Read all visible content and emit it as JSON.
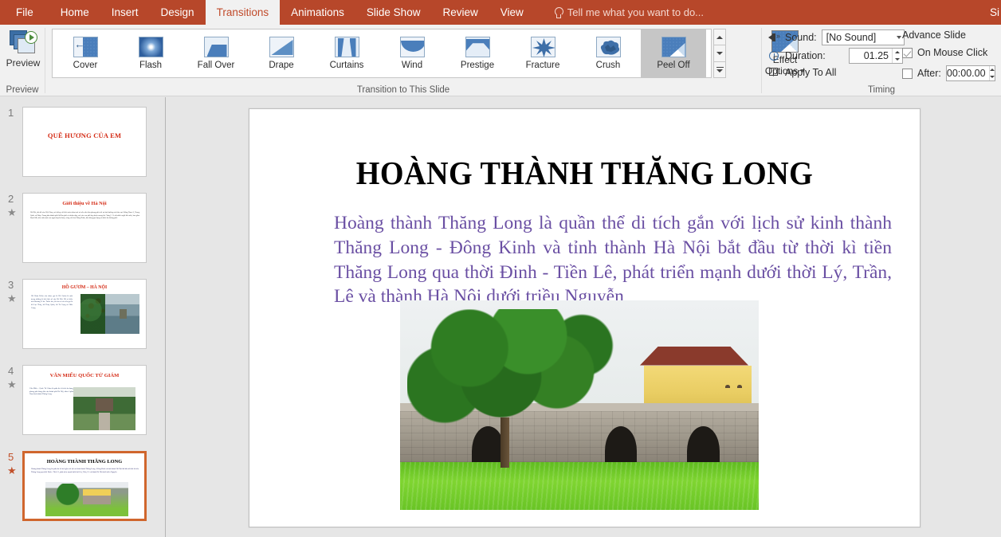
{
  "app": {
    "tabs": [
      {
        "label": "File",
        "active": false
      },
      {
        "label": "Home",
        "active": false
      },
      {
        "label": "Insert",
        "active": false
      },
      {
        "label": "Design",
        "active": false
      },
      {
        "label": "Transitions",
        "active": true
      },
      {
        "label": "Animations",
        "active": false
      },
      {
        "label": "Slide Show",
        "active": false
      },
      {
        "label": "Review",
        "active": false
      },
      {
        "label": "View",
        "active": false
      }
    ],
    "tell_me": "Tell me what you want to do...",
    "sign_in": "Si",
    "accent_color": "#b7472a",
    "active_tab_text_color": "#c14b2b"
  },
  "ribbon": {
    "preview_group": {
      "button_label": "Preview",
      "caption": "Preview",
      "icon": "preview-play-icon"
    },
    "transitions_group": {
      "caption": "Transition to This Slide",
      "items": [
        {
          "label": "Cover",
          "selected": false
        },
        {
          "label": "Flash",
          "selected": false
        },
        {
          "label": "Fall Over",
          "selected": false
        },
        {
          "label": "Drape",
          "selected": false
        },
        {
          "label": "Curtains",
          "selected": false
        },
        {
          "label": "Wind",
          "selected": false
        },
        {
          "label": "Prestige",
          "selected": false
        },
        {
          "label": "Fracture",
          "selected": false
        },
        {
          "label": "Crush",
          "selected": false
        },
        {
          "label": "Peel Off",
          "selected": true
        }
      ],
      "scroll_up": "scroll-up-icon",
      "scroll_down": "scroll-down-icon",
      "more": "gallery-more-icon",
      "effect_options_line1": "Effect",
      "effect_options_line2": "Options"
    },
    "timing_group": {
      "caption": "Timing",
      "sound_label": "Sound:",
      "sound_value": "[No Sound]",
      "duration_label": "Duration:",
      "duration_value": "01.25",
      "apply_to_all_label": "Apply To All",
      "advance_slide_label": "Advance Slide",
      "on_mouse_click_label": "On Mouse Click",
      "on_mouse_click_checked": true,
      "after_label": "After:",
      "after_checked": false,
      "after_value": "00:00.00"
    }
  },
  "thumbnails": [
    {
      "number": "1",
      "has_transition": false,
      "selected": false,
      "title": "QUÊ HƯƠNG CỦA EM",
      "body": ""
    },
    {
      "number": "2",
      "has_transition": true,
      "selected": false,
      "title": "Giới thiệu về Hà Nội",
      "body": "Hà Nội, thủ đô của Việt Nam, nổi tiếng với kiến trúc trăm tuổi và nền văn hóa phong phú với sự ảnh hưởng của khu vực Đông Nam Á, Trung Quốc và Pháp. Trung tâm thành phố là Khu phố cổ nhộn nhịp, nơi các con phố hẹp được mang tên \"hàng\". Có rất nhiều ngôi đền nhỏ, bao gồm Bạch Mã, tôn vinh một con ngựa huyền thoại, cùng với chợ Đồng Xuân, bán hàng gia dụng và thức ăn đường phố."
    },
    {
      "number": "3",
      "has_transition": true,
      "selected": false,
      "title": "HỒ GƯƠM – HÀ NỘI",
      "body": "Hồ Hoàn Kiếm còn được gọi là Hồ Gươm là một trong những di tích lịch sử của Hà Nội. Hồ có diện tích khoảng 12 ha. Trước kia, hồ còn có các tên gọi là hồ Lục Thủy, hồ Thủy Quân, hồ Tả Vọng và Hữu Vọng."
    },
    {
      "number": "4",
      "has_transition": true,
      "selected": false,
      "title": "VĂN MIẾU QUỐC TỬ GIÁM",
      "body": "Văn Miếu – Quốc Tử Giám là quần thể di tích đa dạng, phong phú hàng đầu của thành phố Hà Nội, nằm ở phía Nam kinh thành Thăng Long."
    },
    {
      "number": "5",
      "has_transition": true,
      "selected": true,
      "title": "HOÀNG THÀNH THĂNG LONG",
      "body": "Hoàng thành Thăng Long là quần thể di tích gắn với lịch sử kinh thành Thăng Long - Đông Kinh và tỉnh thành Hà Nội bắt đầu từ thời kì tiền Thăng Long qua thời Đinh - Tiền Lê, phát triển mạnh dưới thời Lý, Trần, Lê và thành Hà Nội dưới triều Nguyễn"
    }
  ],
  "slide": {
    "title": "HOÀNG THÀNH THĂNG LONG",
    "title_color": "#000000",
    "body": "Hoàng thành Thăng Long là quần thể di tích gắn với lịch sử kinh thành Thăng Long - Đông Kinh và tỉnh thành Hà Nội bắt đầu từ thời kì tiền Thăng Long qua thời Đinh - Tiền Lê, phát triển mạnh dưới thời Lý, Trần, Lê và thành Hà Nội dưới triều Nguyễn",
    "body_color": "#6a4fa3",
    "image_alt": "hoang-thanh-thang-long-citadel-photo"
  }
}
